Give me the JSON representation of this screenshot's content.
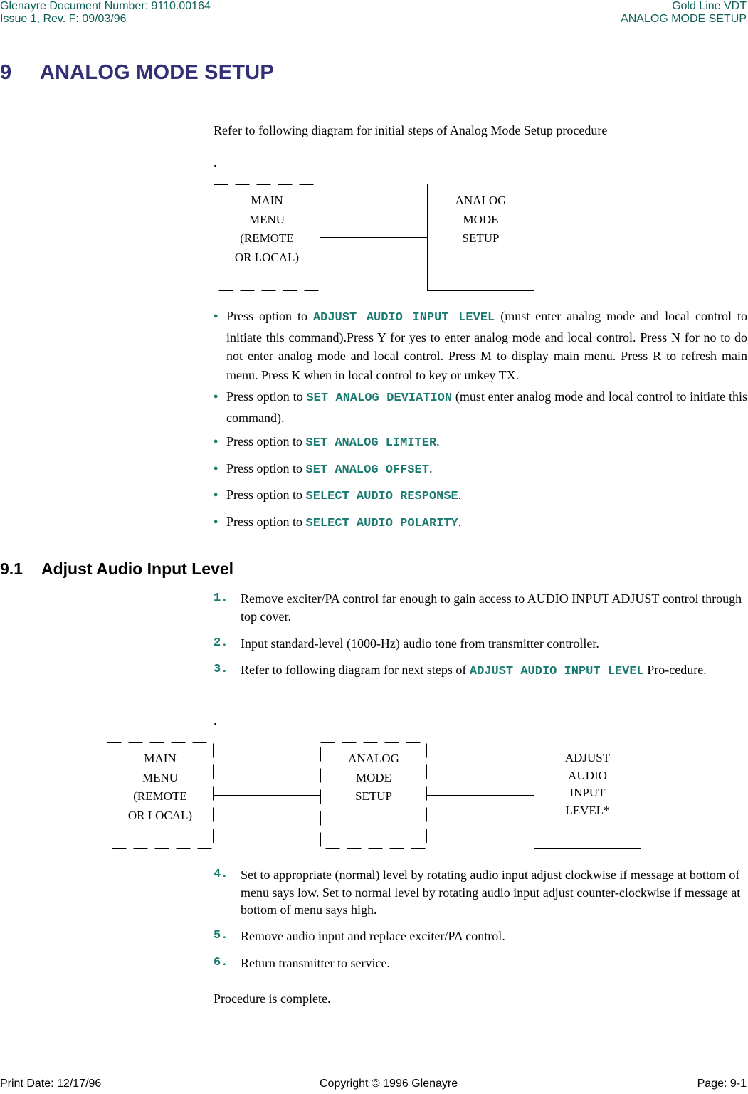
{
  "header": {
    "doc_number": "Glenayre Document Number: 9110.00164",
    "issue": "Issue 1, Rev. F: 09/03/96",
    "product": "Gold Line VDT",
    "section": "ANALOG MODE SETUP"
  },
  "chapter": {
    "number": "9",
    "title": "ANALOG MODE SETUP"
  },
  "intro": {
    "text": "Refer to following diagram for initial steps of Analog Mode Setup procedure",
    "dot": "."
  },
  "diagram1": {
    "boxes": [
      {
        "lines": [
          "MAIN",
          "MENU",
          "(REMOTE",
          "OR LOCAL)"
        ],
        "style": "dashed"
      },
      {
        "lines": [
          "ANALOG",
          "MODE",
          "SETUP"
        ],
        "style": "solid"
      }
    ]
  },
  "bullets": [
    {
      "prefix": "Press option to ",
      "command": "ADJUST AUDIO INPUT LEVEL",
      "suffix": " (must enter analog mode and local control to initiate this command).Press Y for yes to enter analog mode and local control. Press N for no to do not enter analog mode and local control. Press M to display main menu. Press R to refresh main menu. Press K when in local control to key or unkey TX."
    },
    {
      "prefix": "Press option to ",
      "command": "SET ANALOG DEVIATION",
      "suffix": " (must enter analog mode and local control to initiate this command)."
    },
    {
      "prefix": "Press option to ",
      "command": "SET ANALOG LIMITER",
      "suffix": "."
    },
    {
      "prefix": "Press option to ",
      "command": "SET ANALOG OFFSET",
      "suffix": "."
    },
    {
      "prefix": "Press option to ",
      "command": "SELECT AUDIO RESPONSE",
      "suffix": "."
    },
    {
      "prefix": "Press option to ",
      "command": "SELECT AUDIO POLARITY",
      "suffix": "."
    }
  ],
  "bullet_mark": "•",
  "section": {
    "number": "9.1",
    "title": "Adjust Audio Input Level"
  },
  "steps_a": [
    {
      "num": "1.",
      "text": "Remove exciter/PA control far enough to gain access to AUDIO INPUT ADJUST control through top cover."
    },
    {
      "num": "2.",
      "text": "Input standard-level (1000-Hz) audio tone from transmitter controller."
    },
    {
      "num": "3.",
      "prefix": "Refer to following diagram for next steps of ",
      "command": "ADJUST AUDIO INPUT LEVEL",
      "suffix": " Pro-cedure."
    }
  ],
  "diagram2": {
    "dot": ".",
    "boxes": [
      {
        "lines": [
          "MAIN",
          "MENU",
          "(REMOTE",
          "OR LOCAL)"
        ],
        "style": "dashed"
      },
      {
        "lines": [
          "ANALOG",
          "MODE",
          "SETUP"
        ],
        "style": "dashed"
      },
      {
        "lines": [
          "ADJUST",
          "AUDIO",
          "INPUT",
          "LEVEL*"
        ],
        "style": "solid"
      }
    ]
  },
  "steps_b": [
    {
      "num": "4.",
      "text": "Set to appropriate (normal) level by rotating audio input adjust clockwise if message at bottom of menu says low. Set to normal level by rotating audio input adjust counter-clockwise if message at bottom of menu says high."
    },
    {
      "num": "5.",
      "text": "Remove audio input and replace exciter/PA control."
    },
    {
      "num": "6.",
      "text": "Return transmitter to service."
    }
  ],
  "closing": "Procedure is complete.",
  "footer": {
    "print_date": "Print Date: 12/17/96",
    "copyright": "Copyright © 1996 Glenayre",
    "page": "Page: 9-1"
  }
}
